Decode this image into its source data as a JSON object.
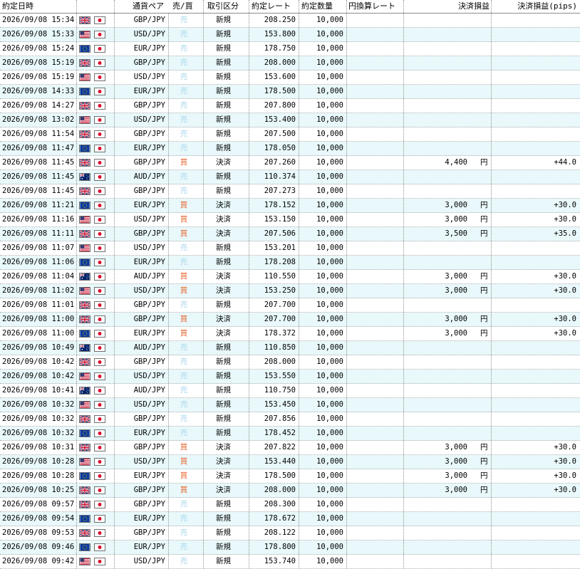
{
  "headers": {
    "datetime": "約定日時",
    "pair": "通貨ペア",
    "side": "売/買",
    "kind": "取引区分",
    "rate": "約定レート",
    "qty": "約定数量",
    "jpy_rate": "円換算レート",
    "pl": "決済損益",
    "pips": "決済損益(pips)"
  },
  "currency_unit": "円",
  "colors": {
    "row_alt": "#e8f8fb",
    "sell": "#aed8ec",
    "buy": "#e8622a"
  },
  "rows": [
    {
      "datetime": "2026/09/08 15:34",
      "base": "gbp-flag-icon",
      "quote": "jpy-flag-icon",
      "pair": "GBP/JPY",
      "side": "売",
      "kind": "新規",
      "rate": "208.250",
      "qty": "10,000",
      "pl": "",
      "unit": "",
      "pips": ""
    },
    {
      "datetime": "2026/09/08 15:33",
      "base": "usd-flag-icon",
      "quote": "jpy-flag-icon",
      "pair": "USD/JPY",
      "side": "売",
      "kind": "新規",
      "rate": "153.800",
      "qty": "10,000",
      "pl": "",
      "unit": "",
      "pips": ""
    },
    {
      "datetime": "2026/09/08 15:24",
      "base": "eur-flag-icon",
      "quote": "jpy-flag-icon",
      "pair": "EUR/JPY",
      "side": "売",
      "kind": "新規",
      "rate": "178.750",
      "qty": "10,000",
      "pl": "",
      "unit": "",
      "pips": ""
    },
    {
      "datetime": "2026/09/08 15:19",
      "base": "gbp-flag-icon",
      "quote": "jpy-flag-icon",
      "pair": "GBP/JPY",
      "side": "売",
      "kind": "新規",
      "rate": "208.000",
      "qty": "10,000",
      "pl": "",
      "unit": "",
      "pips": ""
    },
    {
      "datetime": "2026/09/08 15:19",
      "base": "usd-flag-icon",
      "quote": "jpy-flag-icon",
      "pair": "USD/JPY",
      "side": "売",
      "kind": "新規",
      "rate": "153.600",
      "qty": "10,000",
      "pl": "",
      "unit": "",
      "pips": ""
    },
    {
      "datetime": "2026/09/08 14:33",
      "base": "eur-flag-icon",
      "quote": "jpy-flag-icon",
      "pair": "EUR/JPY",
      "side": "売",
      "kind": "新規",
      "rate": "178.500",
      "qty": "10,000",
      "pl": "",
      "unit": "",
      "pips": ""
    },
    {
      "datetime": "2026/09/08 14:27",
      "base": "gbp-flag-icon",
      "quote": "jpy-flag-icon",
      "pair": "GBP/JPY",
      "side": "売",
      "kind": "新規",
      "rate": "207.800",
      "qty": "10,000",
      "pl": "",
      "unit": "",
      "pips": ""
    },
    {
      "datetime": "2026/09/08 13:02",
      "base": "usd-flag-icon",
      "quote": "jpy-flag-icon",
      "pair": "USD/JPY",
      "side": "売",
      "kind": "新規",
      "rate": "153.400",
      "qty": "10,000",
      "pl": "",
      "unit": "",
      "pips": ""
    },
    {
      "datetime": "2026/09/08 11:54",
      "base": "gbp-flag-icon",
      "quote": "jpy-flag-icon",
      "pair": "GBP/JPY",
      "side": "売",
      "kind": "新規",
      "rate": "207.500",
      "qty": "10,000",
      "pl": "",
      "unit": "",
      "pips": ""
    },
    {
      "datetime": "2026/09/08 11:47",
      "base": "eur-flag-icon",
      "quote": "jpy-flag-icon",
      "pair": "EUR/JPY",
      "side": "売",
      "kind": "新規",
      "rate": "178.050",
      "qty": "10,000",
      "pl": "",
      "unit": "",
      "pips": ""
    },
    {
      "datetime": "2026/09/08 11:45",
      "base": "gbp-flag-icon",
      "quote": "jpy-flag-icon",
      "pair": "GBP/JPY",
      "side": "買",
      "kind": "決済",
      "rate": "207.260",
      "qty": "10,000",
      "pl": "4,400",
      "unit": "円",
      "pips": "+44.0"
    },
    {
      "datetime": "2026/09/08 11:45",
      "base": "aud-flag-icon",
      "quote": "jpy-flag-icon",
      "pair": "AUD/JPY",
      "side": "売",
      "kind": "新規",
      "rate": "110.374",
      "qty": "10,000",
      "pl": "",
      "unit": "",
      "pips": ""
    },
    {
      "datetime": "2026/09/08 11:45",
      "base": "gbp-flag-icon",
      "quote": "jpy-flag-icon",
      "pair": "GBP/JPY",
      "side": "売",
      "kind": "新規",
      "rate": "207.273",
      "qty": "10,000",
      "pl": "",
      "unit": "",
      "pips": ""
    },
    {
      "datetime": "2026/09/08 11:21",
      "base": "eur-flag-icon",
      "quote": "jpy-flag-icon",
      "pair": "EUR/JPY",
      "side": "買",
      "kind": "決済",
      "rate": "178.152",
      "qty": "10,000",
      "pl": "3,000",
      "unit": "円",
      "pips": "+30.0"
    },
    {
      "datetime": "2026/09/08 11:16",
      "base": "usd-flag-icon",
      "quote": "jpy-flag-icon",
      "pair": "USD/JPY",
      "side": "買",
      "kind": "決済",
      "rate": "153.150",
      "qty": "10,000",
      "pl": "3,000",
      "unit": "円",
      "pips": "+30.0"
    },
    {
      "datetime": "2026/09/08 11:11",
      "base": "gbp-flag-icon",
      "quote": "jpy-flag-icon",
      "pair": "GBP/JPY",
      "side": "買",
      "kind": "決済",
      "rate": "207.506",
      "qty": "10,000",
      "pl": "3,500",
      "unit": "円",
      "pips": "+35.0"
    },
    {
      "datetime": "2026/09/08 11:07",
      "base": "usd-flag-icon",
      "quote": "jpy-flag-icon",
      "pair": "USD/JPY",
      "side": "売",
      "kind": "新規",
      "rate": "153.201",
      "qty": "10,000",
      "pl": "",
      "unit": "",
      "pips": ""
    },
    {
      "datetime": "2026/09/08 11:06",
      "base": "eur-flag-icon",
      "quote": "jpy-flag-icon",
      "pair": "EUR/JPY",
      "side": "売",
      "kind": "新規",
      "rate": "178.208",
      "qty": "10,000",
      "pl": "",
      "unit": "",
      "pips": ""
    },
    {
      "datetime": "2026/09/08 11:04",
      "base": "aud-flag-icon",
      "quote": "jpy-flag-icon",
      "pair": "AUD/JPY",
      "side": "買",
      "kind": "決済",
      "rate": "110.550",
      "qty": "10,000",
      "pl": "3,000",
      "unit": "円",
      "pips": "+30.0"
    },
    {
      "datetime": "2026/09/08 11:02",
      "base": "usd-flag-icon",
      "quote": "jpy-flag-icon",
      "pair": "USD/JPY",
      "side": "買",
      "kind": "決済",
      "rate": "153.250",
      "qty": "10,000",
      "pl": "3,000",
      "unit": "円",
      "pips": "+30.0"
    },
    {
      "datetime": "2026/09/08 11:01",
      "base": "gbp-flag-icon",
      "quote": "jpy-flag-icon",
      "pair": "GBP/JPY",
      "side": "売",
      "kind": "新規",
      "rate": "207.700",
      "qty": "10,000",
      "pl": "",
      "unit": "",
      "pips": ""
    },
    {
      "datetime": "2026/09/08 11:00",
      "base": "gbp-flag-icon",
      "quote": "jpy-flag-icon",
      "pair": "GBP/JPY",
      "side": "買",
      "kind": "決済",
      "rate": "207.700",
      "qty": "10,000",
      "pl": "3,000",
      "unit": "円",
      "pips": "+30.0"
    },
    {
      "datetime": "2026/09/08 11:00",
      "base": "eur-flag-icon",
      "quote": "jpy-flag-icon",
      "pair": "EUR/JPY",
      "side": "買",
      "kind": "決済",
      "rate": "178.372",
      "qty": "10,000",
      "pl": "3,000",
      "unit": "円",
      "pips": "+30.0"
    },
    {
      "datetime": "2026/09/08 10:49",
      "base": "aud-flag-icon",
      "quote": "jpy-flag-icon",
      "pair": "AUD/JPY",
      "side": "売",
      "kind": "新規",
      "rate": "110.850",
      "qty": "10,000",
      "pl": "",
      "unit": "",
      "pips": ""
    },
    {
      "datetime": "2026/09/08 10:42",
      "base": "gbp-flag-icon",
      "quote": "jpy-flag-icon",
      "pair": "GBP/JPY",
      "side": "売",
      "kind": "新規",
      "rate": "208.000",
      "qty": "10,000",
      "pl": "",
      "unit": "",
      "pips": ""
    },
    {
      "datetime": "2026/09/08 10:42",
      "base": "usd-flag-icon",
      "quote": "jpy-flag-icon",
      "pair": "USD/JPY",
      "side": "売",
      "kind": "新規",
      "rate": "153.550",
      "qty": "10,000",
      "pl": "",
      "unit": "",
      "pips": ""
    },
    {
      "datetime": "2026/09/08 10:41",
      "base": "aud-flag-icon",
      "quote": "jpy-flag-icon",
      "pair": "AUD/JPY",
      "side": "売",
      "kind": "新規",
      "rate": "110.750",
      "qty": "10,000",
      "pl": "",
      "unit": "",
      "pips": ""
    },
    {
      "datetime": "2026/09/08 10:32",
      "base": "usd-flag-icon",
      "quote": "jpy-flag-icon",
      "pair": "USD/JPY",
      "side": "売",
      "kind": "新規",
      "rate": "153.450",
      "qty": "10,000",
      "pl": "",
      "unit": "",
      "pips": ""
    },
    {
      "datetime": "2026/09/08 10:32",
      "base": "gbp-flag-icon",
      "quote": "jpy-flag-icon",
      "pair": "GBP/JPY",
      "side": "売",
      "kind": "新規",
      "rate": "207.856",
      "qty": "10,000",
      "pl": "",
      "unit": "",
      "pips": ""
    },
    {
      "datetime": "2026/09/08 10:32",
      "base": "eur-flag-icon",
      "quote": "jpy-flag-icon",
      "pair": "EUR/JPY",
      "side": "売",
      "kind": "新規",
      "rate": "178.452",
      "qty": "10,000",
      "pl": "",
      "unit": "",
      "pips": ""
    },
    {
      "datetime": "2026/09/08 10:31",
      "base": "gbp-flag-icon",
      "quote": "jpy-flag-icon",
      "pair": "GBP/JPY",
      "side": "買",
      "kind": "決済",
      "rate": "207.822",
      "qty": "10,000",
      "pl": "3,000",
      "unit": "円",
      "pips": "+30.0"
    },
    {
      "datetime": "2026/09/08 10:28",
      "base": "usd-flag-icon",
      "quote": "jpy-flag-icon",
      "pair": "USD/JPY",
      "side": "買",
      "kind": "決済",
      "rate": "153.440",
      "qty": "10,000",
      "pl": "3,000",
      "unit": "円",
      "pips": "+30.0"
    },
    {
      "datetime": "2026/09/08 10:28",
      "base": "eur-flag-icon",
      "quote": "jpy-flag-icon",
      "pair": "EUR/JPY",
      "side": "買",
      "kind": "決済",
      "rate": "178.500",
      "qty": "10,000",
      "pl": "3,000",
      "unit": "円",
      "pips": "+30.0"
    },
    {
      "datetime": "2026/09/08 10:25",
      "base": "gbp-flag-icon",
      "quote": "jpy-flag-icon",
      "pair": "GBP/JPY",
      "side": "買",
      "kind": "決済",
      "rate": "208.000",
      "qty": "10,000",
      "pl": "3,000",
      "unit": "円",
      "pips": "+30.0"
    },
    {
      "datetime": "2026/09/08 09:57",
      "base": "gbp-flag-icon",
      "quote": "jpy-flag-icon",
      "pair": "GBP/JPY",
      "side": "売",
      "kind": "新規",
      "rate": "208.300",
      "qty": "10,000",
      "pl": "",
      "unit": "",
      "pips": ""
    },
    {
      "datetime": "2026/09/08 09:54",
      "base": "eur-flag-icon",
      "quote": "jpy-flag-icon",
      "pair": "EUR/JPY",
      "side": "売",
      "kind": "新規",
      "rate": "178.672",
      "qty": "10,000",
      "pl": "",
      "unit": "",
      "pips": ""
    },
    {
      "datetime": "2026/09/08 09:53",
      "base": "gbp-flag-icon",
      "quote": "jpy-flag-icon",
      "pair": "GBP/JPY",
      "side": "売",
      "kind": "新規",
      "rate": "208.122",
      "qty": "10,000",
      "pl": "",
      "unit": "",
      "pips": ""
    },
    {
      "datetime": "2026/09/08 09:46",
      "base": "eur-flag-icon",
      "quote": "jpy-flag-icon",
      "pair": "EUR/JPY",
      "side": "売",
      "kind": "新規",
      "rate": "178.800",
      "qty": "10,000",
      "pl": "",
      "unit": "",
      "pips": ""
    },
    {
      "datetime": "2026/09/08 09:42",
      "base": "usd-flag-icon",
      "quote": "jpy-flag-icon",
      "pair": "USD/JPY",
      "side": "売",
      "kind": "新規",
      "rate": "153.740",
      "qty": "10,000",
      "pl": "",
      "unit": "",
      "pips": ""
    }
  ]
}
